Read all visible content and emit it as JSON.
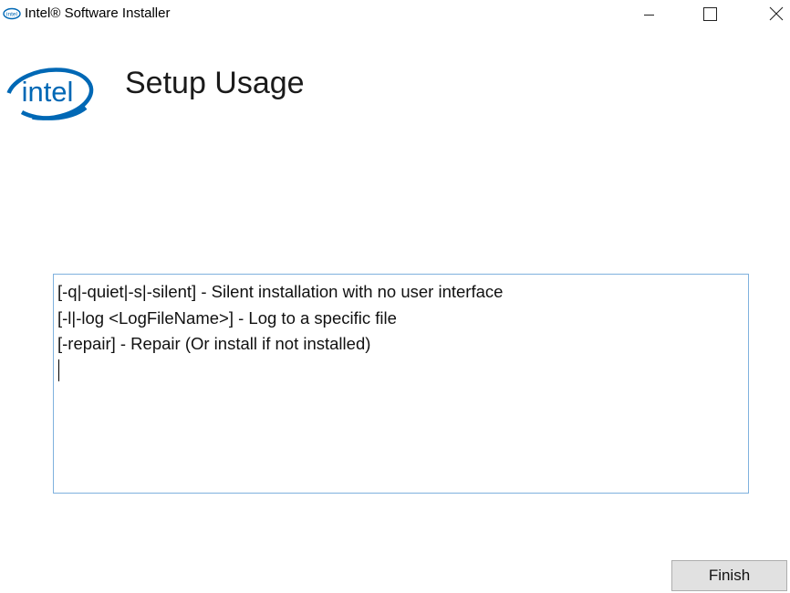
{
  "window": {
    "title": "Intel® Software Installer",
    "controls": {
      "minimize": "minimize-icon",
      "maximize": "maximize-icon",
      "close": "close-icon"
    }
  },
  "header": {
    "logo_text": "intel",
    "page_title": "Setup Usage"
  },
  "usage": {
    "lines": [
      "[-q|-quiet|-s|-silent] - Silent installation with no user interface",
      "[-l|-log <LogFileName>] - Log to a specific file",
      "[-repair] - Repair (Or install if not installed)"
    ]
  },
  "footer": {
    "finish_label": "Finish"
  },
  "colors": {
    "intel_blue": "#0068b5",
    "box_border": "#7fb1de",
    "button_bg": "#e1e1e1"
  }
}
